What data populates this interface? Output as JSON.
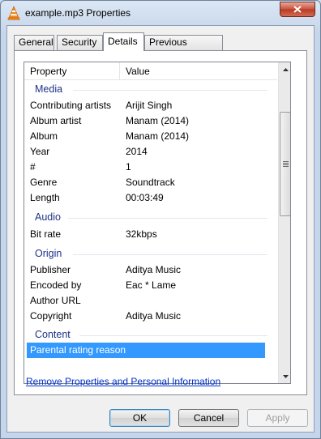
{
  "window": {
    "title": "example.mp3 Properties"
  },
  "tabs": [
    {
      "label": "General"
    },
    {
      "label": "Security"
    },
    {
      "label": "Details"
    },
    {
      "label": "Previous Versions"
    }
  ],
  "list": {
    "header": {
      "property": "Property",
      "value": "Value"
    },
    "groups": {
      "media": "Media",
      "audio": "Audio",
      "origin": "Origin",
      "content": "Content"
    },
    "media_rows": [
      {
        "key": "Contributing artists",
        "value": "Arijit Singh"
      },
      {
        "key": "Album artist",
        "value": "Manam (2014)"
      },
      {
        "key": "Album",
        "value": "Manam (2014)"
      },
      {
        "key": "Year",
        "value": "2014"
      },
      {
        "key": "#",
        "value": "1"
      },
      {
        "key": "Genre",
        "value": "Soundtrack"
      },
      {
        "key": "Length",
        "value": "00:03:49"
      }
    ],
    "audio_rows": [
      {
        "key": "Bit rate",
        "value": "32kbps"
      }
    ],
    "origin_rows": [
      {
        "key": "Publisher",
        "value": "Aditya Music"
      },
      {
        "key": "Encoded by",
        "value": "Eac * Lame"
      },
      {
        "key": "Author URL",
        "value": ""
      },
      {
        "key": "Copyright",
        "value": "Aditya Music"
      }
    ],
    "content_rows": [
      {
        "key": "Parental rating reason",
        "value": ""
      }
    ]
  },
  "remove_link": "Remove Properties and Personal Information",
  "buttons": {
    "ok": "OK",
    "cancel": "Cancel",
    "apply": "Apply"
  },
  "colors": {
    "selection": "#3399ff",
    "group_label": "#1e3287",
    "link": "#0033cc"
  },
  "icons": {
    "app": "vlc-cone-icon",
    "close": "close-icon"
  }
}
